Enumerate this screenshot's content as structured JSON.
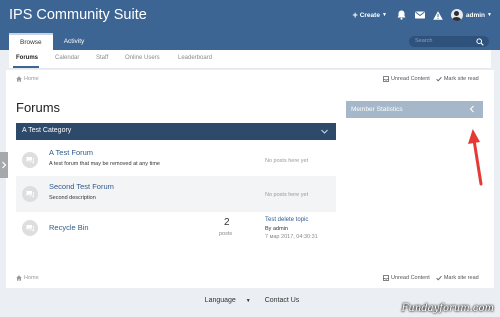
{
  "header": {
    "brand": "IPS Community Suite",
    "create_label": "Create",
    "user_name": "admin",
    "tabs": [
      {
        "label": "Browse"
      },
      {
        "label": "Activity"
      }
    ],
    "search_placeholder": "Search"
  },
  "subnav": {
    "items": [
      {
        "label": "Forums"
      },
      {
        "label": "Calendar"
      },
      {
        "label": "Staff"
      },
      {
        "label": "Online Users"
      },
      {
        "label": "Leaderboard"
      }
    ]
  },
  "breadcrumb": {
    "home": "Home",
    "unread": "Unread Content",
    "mark_read": "Mark site read"
  },
  "page": {
    "title": "Forums",
    "category": "A Test Category",
    "rows": [
      {
        "title": "A Test Forum",
        "description": "A test forum that may be removed at any time",
        "last": "No posts here yet"
      },
      {
        "title": "Second Test Forum",
        "description": "Second description",
        "last": "No posts here yet"
      },
      {
        "title": "Recycle Bin",
        "posts": "2",
        "posts_label": "posts",
        "last_title": "Test delete topic",
        "last_by": "By admin",
        "last_date": "7 мар 2017, 04:30:31"
      }
    ]
  },
  "sidebar": {
    "widget_title": "Member Statistics"
  },
  "footer": {
    "language": "Language",
    "contact": "Contact Us"
  },
  "watermark": "Fundayforum.com",
  "colors": {
    "header": "#3d6594",
    "category_bar": "#2d4a6b",
    "widget": "#a5b7c9",
    "annotation_arrow": "#e53935"
  }
}
